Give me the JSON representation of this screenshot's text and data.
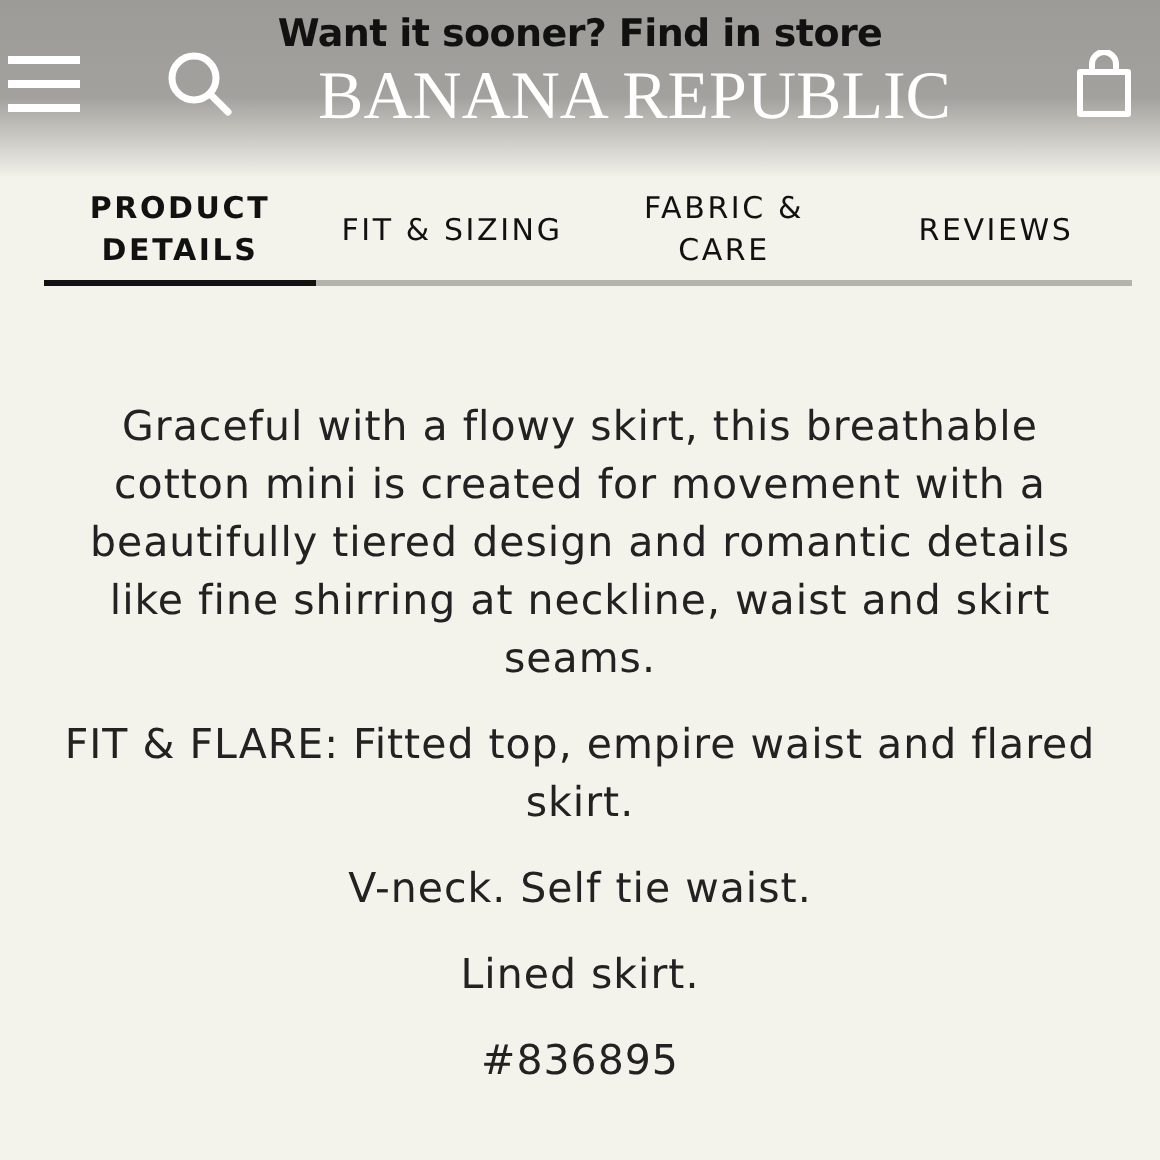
{
  "header": {
    "promo": "Want it sooner? Find in store",
    "logo": "BANANA REPUBLIC"
  },
  "tabs": [
    {
      "label": "PRODUCT DETAILS",
      "selected": true
    },
    {
      "label": "FIT & SIZING",
      "selected": false
    },
    {
      "label": "FABRIC & CARE",
      "selected": false
    },
    {
      "label": "REVIEWS",
      "selected": false
    }
  ],
  "paragraphs": [
    "Graceful with a flowy skirt, this breathable cotton mini is created for movement with a beautifully tiered design and romantic details like fine shirring at neckline, waist and skirt seams.",
    "FIT & FLARE: Fitted top, empire waist and flared skirt.",
    "V-neck. Self tie waist.",
    "Lined skirt.",
    "#836895"
  ]
}
